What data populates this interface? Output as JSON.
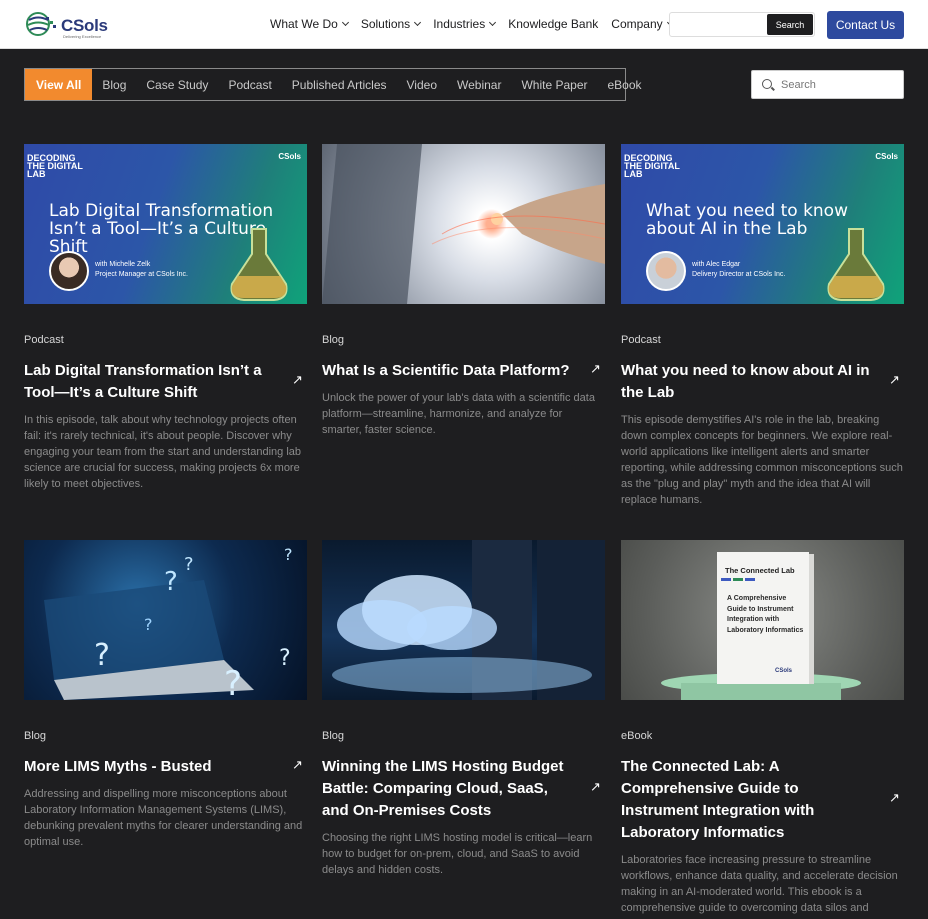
{
  "header": {
    "logo_text": "CSols",
    "logo_tagline": "Delivering Excellence",
    "nav": [
      {
        "label": "What We Do",
        "dropdown": true
      },
      {
        "label": "Solutions",
        "dropdown": true
      },
      {
        "label": "Industries",
        "dropdown": true
      },
      {
        "label": "Knowledge Bank",
        "dropdown": false
      },
      {
        "label": "Company",
        "dropdown": true
      }
    ],
    "search_placeholder": "",
    "search_button": "Search",
    "contact_button": "Contact Us"
  },
  "filters": {
    "items": [
      "View All",
      "Blog",
      "Case Study",
      "Podcast",
      "Published Articles",
      "Video",
      "Webinar",
      "White Paper",
      "eBook"
    ],
    "active": "View All",
    "search_placeholder": "Search"
  },
  "cards": [
    {
      "category": "Podcast",
      "title": "Lab Digital Transformation Isn’t a Tool—It’s a Culture Shift",
      "description": "In this episode, talk about why technology projects often fail: it's rarely technical, it's about people. Discover why engaging your team from the start and understanding lab science are crucial for success, making projects 6x more likely to meet objectives.",
      "thumb": {
        "series": "DECODING THE DIGITAL LAB",
        "brand": "CSols",
        "headline": "Lab Digital Transformation Isn’t a Tool—It’s a Culture Shift",
        "with": "with Michelle Zelk",
        "role": "Project Manager at CSols Inc."
      }
    },
    {
      "category": "Blog",
      "title": "What Is a Scientific Data Platform?",
      "description": "Unlock the power of your lab's data with a scientific data platform—streamline, harmonize, and analyze for smarter, faster science."
    },
    {
      "category": "Podcast",
      "title": "What you need to know about AI in the Lab",
      "description": "This episode demystifies AI's role in the lab, breaking down complex concepts for beginners. We explore real-world applications like intelligent alerts and smarter reporting, while addressing common misconceptions such as the \"plug and play\" myth and the idea that AI will replace humans.",
      "thumb": {
        "series": "DECODING THE DIGITAL LAB",
        "brand": "CSols",
        "headline": "What you need to know about AI in the Lab",
        "with": "with Alec Edgar",
        "role": "Delivery Director at CSols Inc."
      }
    },
    {
      "category": "Blog",
      "title": "More LIMS Myths - Busted",
      "description": "Addressing and dispelling more misconceptions about Laboratory Information Management Systems (LIMS), debunking prevalent myths for clearer understanding and optimal use."
    },
    {
      "category": "Blog",
      "title": "Winning the LIMS Hosting Budget Battle: Comparing Cloud, SaaS, and On-Premises Costs",
      "description": "Choosing the right LIMS hosting model is critical—learn how to budget for on-prem, cloud, and SaaS to avoid delays and hidden costs."
    },
    {
      "category": "eBook",
      "title": "The Connected Lab: A Comprehensive Guide to Instrument Integration with Laboratory Informatics",
      "description": "Laboratories face increasing pressure to streamline workflows, enhance data quality, and accelerate decision making in an AI-moderated world. This ebook is a comprehensive guide to overcoming data silos and",
      "thumb": {
        "book_title": "The Connected Lab",
        "book_subtitle": "A Comprehensive Guide to Instrument Integration with Laboratory Informatics",
        "brand": "CSols"
      }
    }
  ],
  "colors": {
    "accent": "#f28a2e",
    "brand": "#2e4a9e",
    "background": "#1e1e20"
  }
}
